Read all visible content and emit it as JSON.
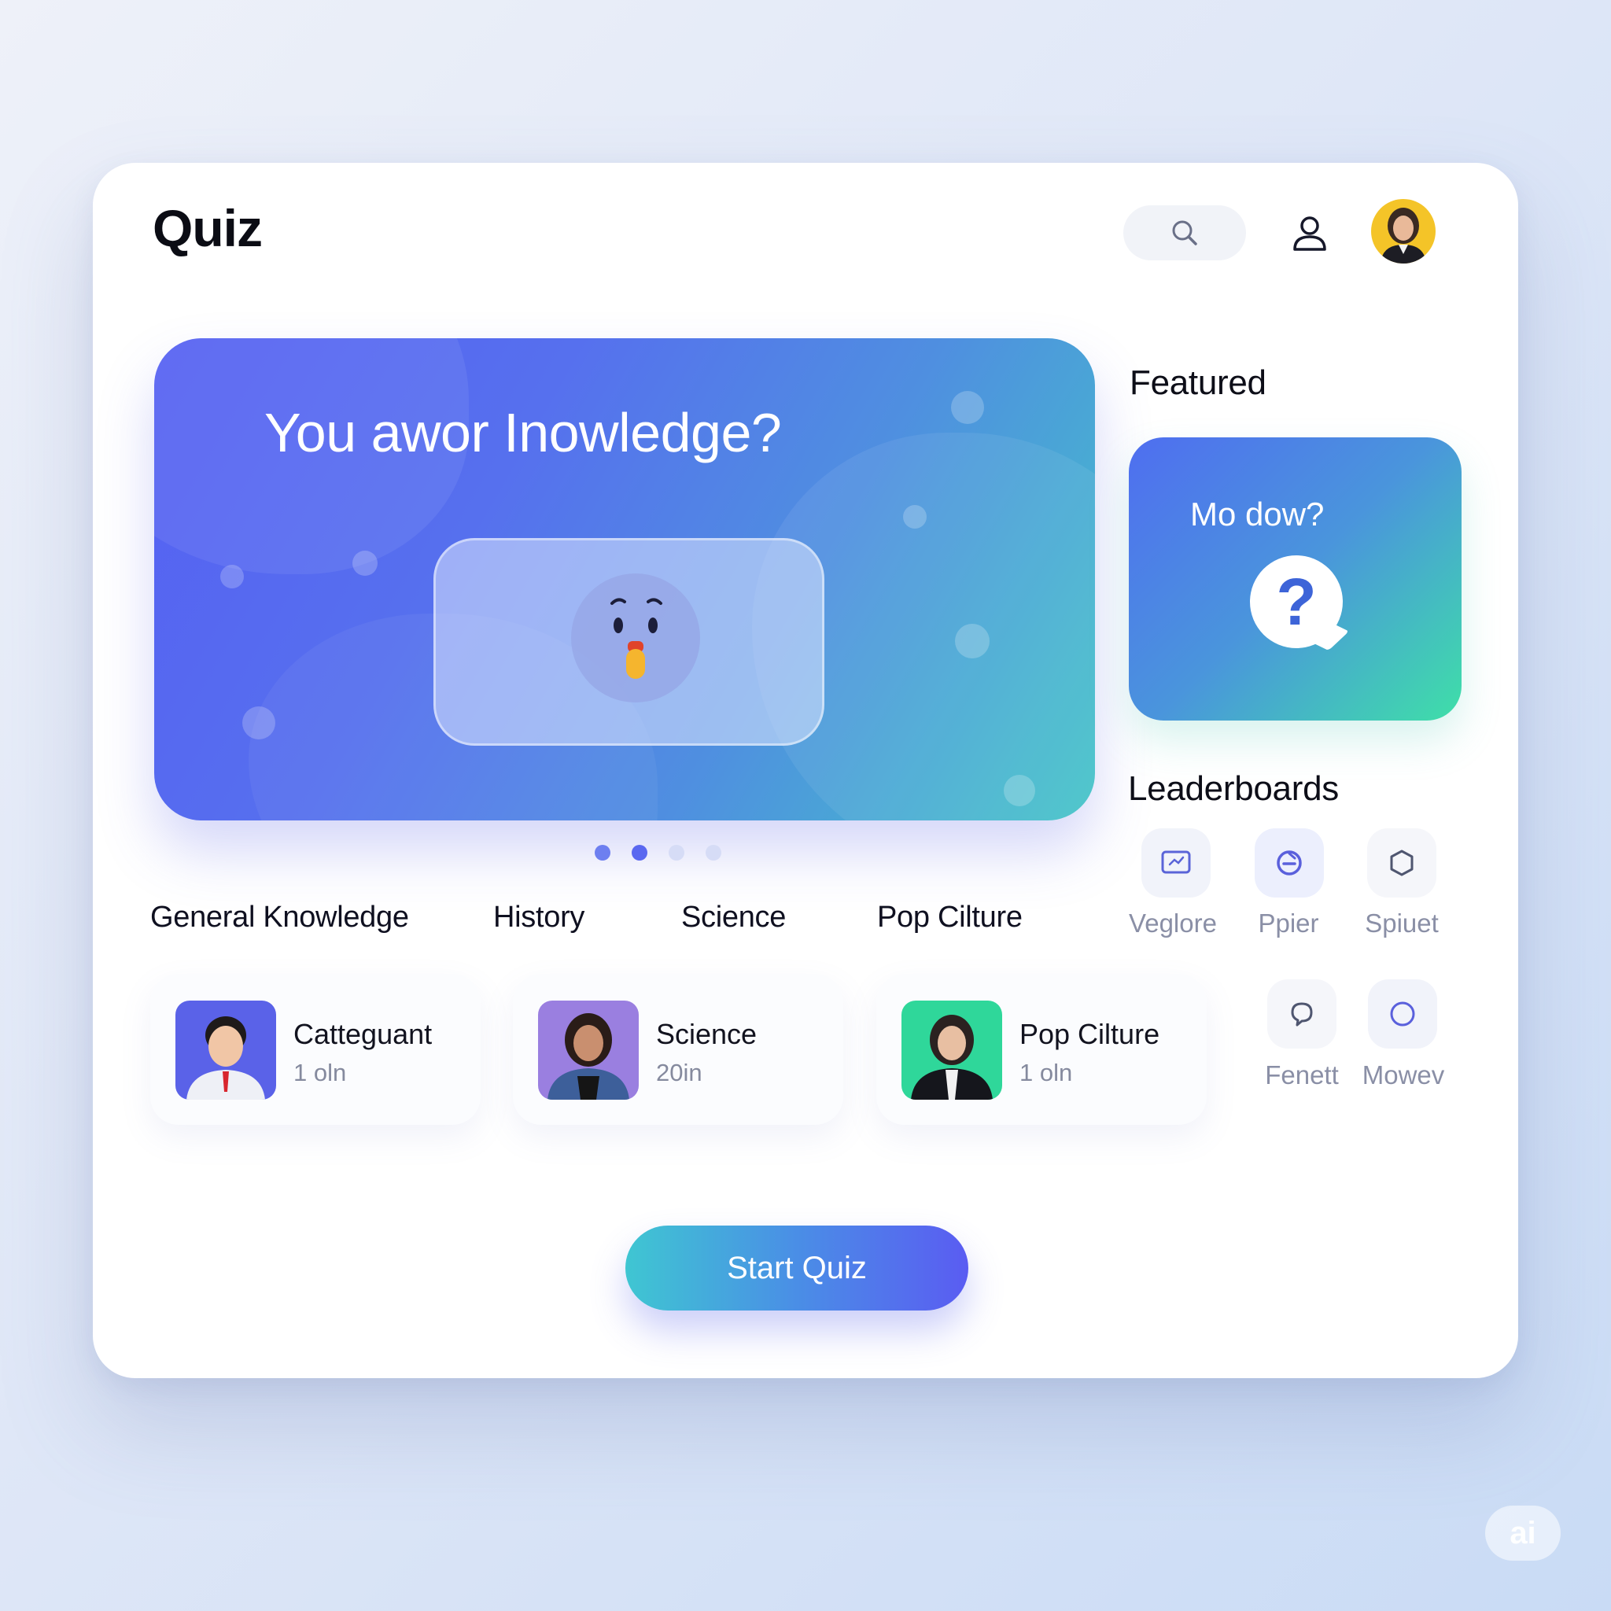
{
  "header": {
    "app_title": "Quiz",
    "search_icon": "search-icon",
    "profile_icon": "user-icon"
  },
  "hero": {
    "title": "You awor Inowledge?",
    "pager_dots": 4,
    "active_dot": 1,
    "colors": {
      "start": "#5560f3",
      "end": "#43c4c8"
    }
  },
  "tabs": [
    "General Knowledge",
    "History",
    "Science",
    "Pop Cilture"
  ],
  "quiz_cards": [
    {
      "title": "Catteguant",
      "subtitle": "1 oln",
      "thumb_bg": "#5a62e8"
    },
    {
      "title": "Science",
      "subtitle": "20in",
      "thumb_bg": "#9a7fe0"
    },
    {
      "title": "Pop Cilture",
      "subtitle": "1 oln",
      "thumb_bg": "#2fd79a"
    }
  ],
  "featured": {
    "heading": "Featured",
    "card_text": "Mo dow?",
    "card_icon": "question-bubble-icon"
  },
  "leaderboards": {
    "heading": "Leaderboards",
    "items": [
      {
        "label": "Veglore",
        "icon": "chart-icon"
      },
      {
        "label": "Ppier",
        "icon": "badge-icon"
      },
      {
        "label": "Spiuet",
        "icon": "hexagon-icon"
      },
      {
        "label": "Fenett",
        "icon": "chat-icon"
      },
      {
        "label": "Mowev",
        "icon": "circle-icon"
      }
    ]
  },
  "cta": {
    "label": "Start Quiz"
  },
  "watermark": "ai"
}
